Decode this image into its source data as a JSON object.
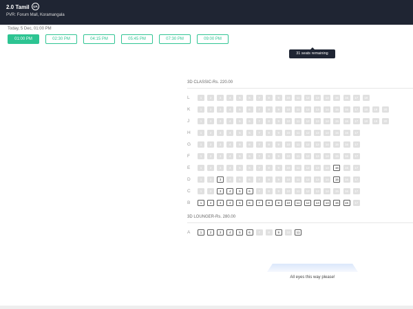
{
  "header": {
    "title": "2.0 Tamil",
    "cert": "UA",
    "venue": "PVR: Forum Mall, Koramangala"
  },
  "showtimes": {
    "date_label": "Today, 5 Dec, 01:00 PM",
    "times": [
      "01:00 PM",
      "02:30 PM",
      "04:15 PM",
      "05:45 PM",
      "07:30 PM",
      "09:00 PM"
    ],
    "selected_index": 0
  },
  "tooltip": "31 seats remaining",
  "sections": [
    {
      "label": "3D CLASSIC-Rs. 220.00",
      "rows": [
        {
          "label": "L",
          "seats": 18,
          "available": []
        },
        {
          "label": "K",
          "seats": 20,
          "available": []
        },
        {
          "label": "J",
          "seats": 20,
          "available": []
        },
        {
          "label": "H",
          "seats": 17,
          "available": []
        },
        {
          "label": "G",
          "seats": 17,
          "available": []
        },
        {
          "label": "F",
          "seats": 17,
          "available": []
        },
        {
          "label": "E",
          "seats": 17,
          "available": [
            15
          ]
        },
        {
          "label": "D",
          "seats": 17,
          "available": [
            3,
            15
          ]
        },
        {
          "label": "C",
          "seats": 17,
          "available": [
            3,
            4,
            5,
            6
          ]
        },
        {
          "label": "B",
          "seats": 17,
          "available": [
            1,
            2,
            3,
            4,
            5,
            6,
            7,
            8,
            9,
            10,
            11,
            12,
            13,
            14,
            15,
            16
          ]
        }
      ]
    },
    {
      "label": "3D LOUNGER-Rs. 280.00",
      "rows": [
        {
          "label": "A",
          "seats": 11,
          "available": [
            1,
            2,
            3,
            4,
            5,
            6,
            9,
            11
          ]
        }
      ]
    }
  ],
  "screen_text": "All eyes this way please!"
}
